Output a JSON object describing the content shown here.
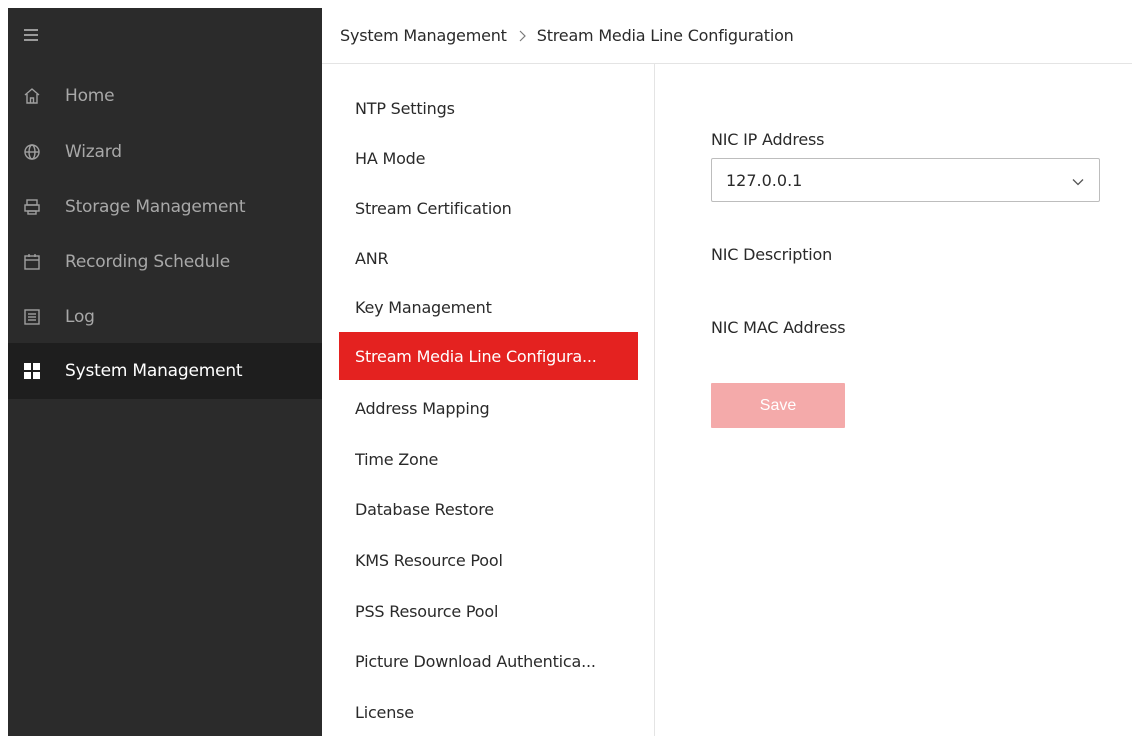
{
  "sidebar": {
    "items": [
      {
        "label": "Home",
        "icon": "home-icon"
      },
      {
        "label": "Wizard",
        "icon": "globe-icon"
      },
      {
        "label": "Storage Management",
        "icon": "storage-icon"
      },
      {
        "label": "Recording Schedule",
        "icon": "calendar-icon"
      },
      {
        "label": "Log",
        "icon": "log-icon"
      },
      {
        "label": "System Management",
        "icon": "grid-icon",
        "active": true
      }
    ]
  },
  "breadcrumb": {
    "parent": "System Management",
    "current": "Stream Media Line Configuration"
  },
  "submenu": {
    "items": [
      {
        "label": "NTP Settings"
      },
      {
        "label": "HA Mode"
      },
      {
        "label": "Stream Certification"
      },
      {
        "label": "ANR"
      },
      {
        "label": "Key Management"
      },
      {
        "label": "Stream Media Line Configura...",
        "active": true
      },
      {
        "label": "Address Mapping"
      },
      {
        "label": "Time Zone"
      },
      {
        "label": "Database Restore"
      },
      {
        "label": "KMS Resource Pool"
      },
      {
        "label": "PSS Resource Pool"
      },
      {
        "label": "Picture Download Authentica..."
      },
      {
        "label": "License"
      }
    ]
  },
  "form": {
    "nic_ip_label": "NIC IP Address",
    "nic_ip_value": "127.0.0.1",
    "nic_description_label": "NIC Description",
    "nic_mac_label": "NIC MAC Address",
    "save_label": "Save"
  },
  "colors": {
    "sidebar_bg": "#2b2b2b",
    "sidebar_active_bg": "#1e1e1e",
    "accent": "#e42220",
    "save_disabled": "#f4aaaa"
  }
}
